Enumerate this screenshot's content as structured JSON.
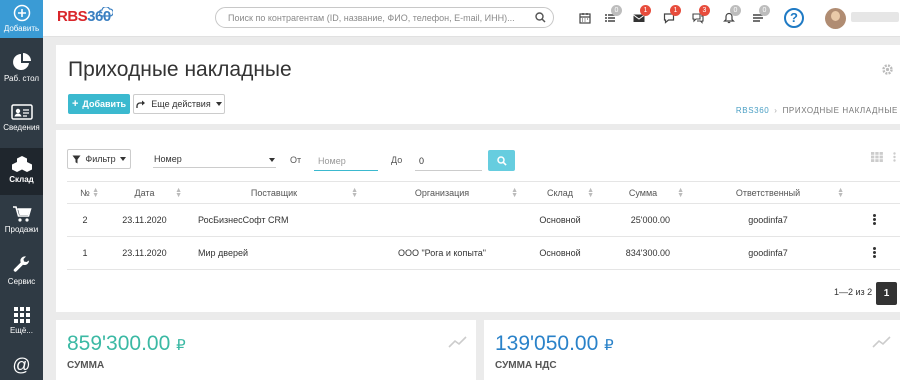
{
  "sidebar": {
    "items": [
      {
        "label": "Добавить",
        "icon": "plus-circle-icon"
      },
      {
        "label": "Раб. стол",
        "icon": "pie-chart-icon"
      },
      {
        "label": "Сведения",
        "icon": "id-card-icon"
      },
      {
        "label": "Склад",
        "icon": "cubes-icon"
      },
      {
        "label": "Продажи",
        "icon": "cart-icon"
      },
      {
        "label": "Сервис",
        "icon": "wrench-icon"
      },
      {
        "label": "Ещё...",
        "icon": "grid-icon"
      },
      {
        "label": "",
        "icon": "at-icon"
      }
    ]
  },
  "topbar": {
    "logo_prefix": "RBS",
    "logo_suffix": "360",
    "search_placeholder": "Поиск по контрагентам (ID, название, ФИО, телефон, E-mail, ИНН)...",
    "notifications": [
      {
        "icon": "calendar-icon",
        "badge": ""
      },
      {
        "icon": "list-icon",
        "badge": "0"
      },
      {
        "icon": "envelope-icon",
        "badge": "1"
      },
      {
        "icon": "chat-icon",
        "badge": "1"
      },
      {
        "icon": "comments-icon",
        "badge": "3"
      },
      {
        "icon": "bell-icon",
        "badge": "0"
      },
      {
        "icon": "tasks-icon",
        "badge": "0"
      }
    ],
    "help_label": "?"
  },
  "page": {
    "title": "Приходные накладные",
    "add_label": "Добавить",
    "more_label": "Еще действия",
    "breadcrumb": [
      "RBS360",
      "ПРИХОДНЫЕ НАКЛАДНЫЕ"
    ]
  },
  "filter": {
    "filter_label": "Фильтр",
    "field_label": "Номер",
    "from_label": "От",
    "from_placeholder": "Номер",
    "to_label": "До",
    "to_value": "0"
  },
  "table": {
    "columns": [
      "№",
      "Дата",
      "Поставщик",
      "Организация",
      "Склад",
      "Сумма",
      "Ответственный"
    ],
    "rows": [
      {
        "num": "2",
        "date": "23.11.2020",
        "supplier": "РосБизнесСофт CRM",
        "org": "",
        "warehouse": "Основной",
        "sum": "25'000.00",
        "responsible": "goodinfa7"
      },
      {
        "num": "1",
        "date": "23.11.2020",
        "supplier": "Мир дверей",
        "org": "ООО \"Рога и копыта\"",
        "warehouse": "Основной",
        "sum": "834'300.00",
        "responsible": "goodinfa7"
      }
    ]
  },
  "pagination": {
    "range_text": "1—2 из 2",
    "current_page": "1"
  },
  "stats": [
    {
      "value": "859'300.00",
      "currency": "₽",
      "caption": "СУММА",
      "color": "#3bb9a4"
    },
    {
      "value": "139'050.00",
      "currency": "₽",
      "caption": "СУММА НДС",
      "color": "#2a82c9"
    }
  ]
}
